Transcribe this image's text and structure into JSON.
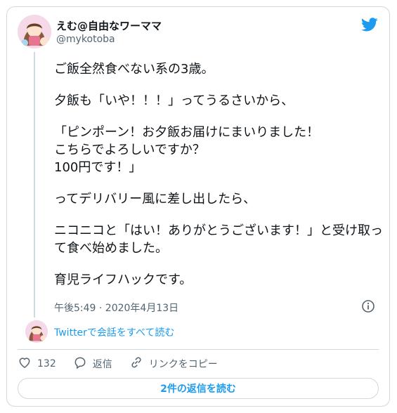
{
  "tweet": {
    "author_name": "えむ@自由なワーママ",
    "author_handle": "@mykotoba",
    "paragraphs": [
      "ご飯全然食べない系の3歳。",
      "夕飯も「いや！！！」ってうるさいから、",
      "「ピンポーン！お夕飯お届けにまいりました！\nこちらでよろしいですか？\n100円です！」",
      "ってデリバリー風に差し出したら、",
      "ニコニコと「はい！ありがとうございます！」と受け取って食べ始めました。",
      "育児ライフハックです。"
    ],
    "timestamp": "午後5:49 · 2020年4月13日",
    "read_all_link": "Twitterで会話をすべて読む"
  },
  "actions": {
    "like_count": "132",
    "reply_label": "返信",
    "copy_link_label": "リンクをコピー"
  },
  "read_replies_button": "2件の返信を読む",
  "icons": {
    "brand": "twitter-bird-icon",
    "info": "info-icon",
    "like": "heart-icon",
    "reply": "reply-bubble-icon",
    "copy": "link-icon"
  },
  "colors": {
    "accent": "#1d9bf0",
    "text": "#0f1419",
    "secondary": "#536471",
    "border": "#cfd9de"
  }
}
